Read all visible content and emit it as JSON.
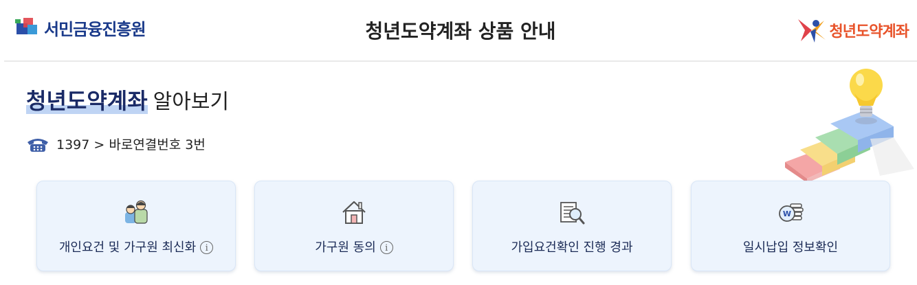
{
  "header": {
    "org_logo_text": "서민금융진흥원",
    "title": "청년도약계좌 상품 안내",
    "product_logo_text": "청년도약계좌"
  },
  "main": {
    "title_highlight": "청년도약계좌",
    "title_rest": "알아보기",
    "phone_text": "1397 > 바로연결번호 3번"
  },
  "cards": [
    {
      "label": "개인요건 및 가구원 최신화",
      "icon": "family-icon",
      "info": "i"
    },
    {
      "label": "가구원 동의",
      "icon": "house-icon",
      "info": "i"
    },
    {
      "label": "가입요건확인 진행 경과",
      "icon": "document-search-icon"
    },
    {
      "label": "일시납입 정보확인",
      "icon": "won-coins-icon"
    }
  ],
  "colors": {
    "brand_blue": "#1a3a8a",
    "brand_orange": "#e8532a",
    "card_bg": "#edf4fd",
    "title_highlight_bg": "#bfd4f4"
  }
}
